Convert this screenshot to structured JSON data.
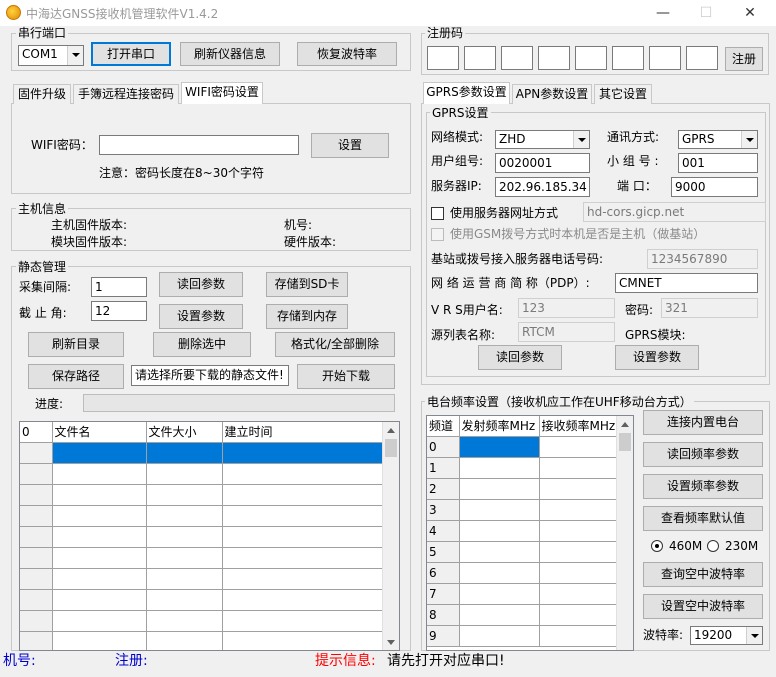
{
  "window": {
    "title": "中海达GNSS接收机管理软件V1.4.2",
    "minimize": "—",
    "maximize": "☐",
    "close": "✕"
  },
  "serial": {
    "group_label": "串行端口",
    "port_value": "COM1",
    "open_port": "打开串口",
    "refresh_info": "刷新仪器信息",
    "restore_baud": "恢复波特率"
  },
  "register": {
    "group_label": "注册码",
    "boxes": [
      "",
      "",
      "",
      "",
      "",
      "",
      "",
      ""
    ],
    "button": "注册"
  },
  "left_tabs": [
    "固件升级",
    "手簿远程连接密码",
    "WIFI密码设置"
  ],
  "wifi": {
    "label": "WIFI密码：",
    "value": "",
    "set_button": "设置",
    "note": "注意：密码长度在8~30个字符"
  },
  "host": {
    "group_label": "主机信息",
    "main_fw": "主机固件版本:",
    "module_fw": "模块固件版本:",
    "machine_no": "机号:",
    "hw_version": "硬件版本:"
  },
  "static": {
    "group_label": "静态管理",
    "interval_label": "采集间隔:",
    "interval_value": "1",
    "cutoff_label": "截 止 角:",
    "cutoff_value": "12",
    "read_params": "读回参数",
    "save_sd": "存储到SD卡",
    "set_params": "设置参数",
    "save_mem": "存储到内存",
    "refresh_dir": "刷新目录",
    "delete_sel": "删除选中",
    "format_all": "格式化/全部删除",
    "save_path": "保存路径",
    "hint": "请选择所要下载的静态文件!",
    "start_download": "开始下载",
    "progress_label": "进度:",
    "progress": 0,
    "table_headers": [
      "0",
      "文件名",
      "文件大小",
      "建立时间"
    ],
    "table_rows": [
      [
        "",
        "",
        "",
        ""
      ],
      [
        "",
        "",
        "",
        ""
      ],
      [
        "",
        "",
        "",
        ""
      ],
      [
        "",
        "",
        "",
        ""
      ],
      [
        "",
        "",
        "",
        ""
      ],
      [
        "",
        "",
        "",
        ""
      ],
      [
        "",
        "",
        "",
        ""
      ],
      [
        "",
        "",
        "",
        ""
      ],
      [
        "",
        "",
        "",
        ""
      ],
      [
        "",
        "",
        "",
        ""
      ]
    ]
  },
  "right_tabs": [
    "GPRS参数设置",
    "APN参数设置",
    "其它设置"
  ],
  "gprs": {
    "group_label": "GPRS设置",
    "network_mode_label": "网络模式:",
    "network_mode_value": "ZHD",
    "comm_mode_label": "通讯方式:",
    "comm_mode_value": "GPRS",
    "user_group_label": "用户组号:",
    "user_group_value": "0020001",
    "subgroup_label": "小 组 号 :",
    "subgroup_value": "001",
    "server_ip_label": "服务器IP:",
    "server_ip_value": "202.96.185.34",
    "port_label": "端  口：",
    "port_value": "9000",
    "use_url_label": "使用服务器网址方式",
    "url_value": "hd-cors.gicp.net",
    "use_gsm_label": "使用GSM拨号方式时本机是否是主机（做基站）",
    "phone_label": "基站或拨号接入服务器电话号码:",
    "phone_value": "1234567890",
    "pdp_label": "网 络 运 营 商 简 称（PDP）:",
    "pdp_value": "CMNET",
    "vrs_user_label": "V R S用户名:",
    "vrs_user_value": "123",
    "password_label": "密码:",
    "password_value": "321",
    "source_label": "源列表名称:",
    "source_value": "RTCM",
    "gprs_module_label": "GPRS模块:",
    "read_params": "读回参数",
    "set_params": "设置参数"
  },
  "radio": {
    "group_label": "电台频率设置（接收机应工作在UHF移动台方式）",
    "headers": [
      "频道",
      "发射频率MHz",
      "接收频率MHz"
    ],
    "channels": [
      "0",
      "1",
      "2",
      "3",
      "4",
      "5",
      "6",
      "7",
      "8",
      "9"
    ],
    "connect_internal": "连接内置电台",
    "read_freq": "读回频率参数",
    "set_freq": "设置频率参数",
    "view_default": "查看频率默认值",
    "option_460": "460M",
    "option_230": "230M",
    "query_air_baud": "查询空中波特率",
    "set_air_baud": "设置空中波特率",
    "baud_label": "波特率:",
    "baud_value": "19200"
  },
  "status": {
    "machine_label": "机号:",
    "register_label": "注册:",
    "prompt_label": "提示信息:",
    "prompt_text": "请先打开对应串口!",
    "blue": "#0000cc",
    "red": "#ff0000"
  },
  "colors": {
    "selection": "#0078d7"
  }
}
